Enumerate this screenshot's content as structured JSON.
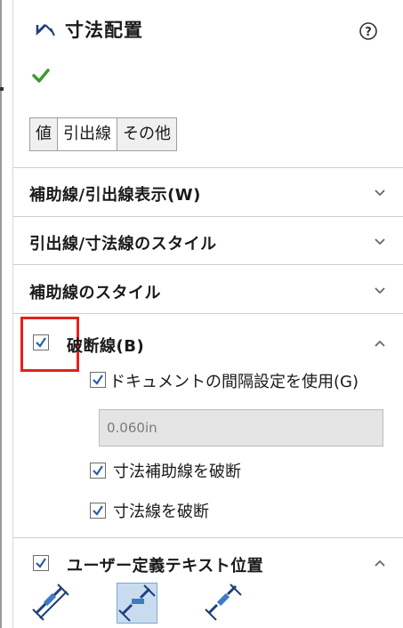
{
  "panel": {
    "title": "寸法配置",
    "icons": {
      "title": "dimension-arrow-icon",
      "help": "help-question-icon",
      "ok": "check-mark-icon"
    }
  },
  "tabs": [
    {
      "label": "値",
      "active": false
    },
    {
      "label": "引出線",
      "active": true
    },
    {
      "label": "その他",
      "active": false
    }
  ],
  "sections": {
    "extension_display": {
      "label": "補助線/引出線表示(W)",
      "state": "collapsed"
    },
    "leader_style": {
      "label": "引出線/寸法線のスタイル",
      "state": "collapsed"
    },
    "extension_style": {
      "label": "補助線のスタイル",
      "state": "collapsed"
    },
    "break_lines": {
      "label": "破断線(B)",
      "checked": true,
      "state": "expanded",
      "use_doc_gap": {
        "label": "ドキュメントの間隔設定を使用(G)",
        "checked": true
      },
      "gap_value": "0.060in",
      "break_extension": {
        "label": "寸法補助線を破断",
        "checked": true
      },
      "break_dimension": {
        "label": "寸法線を破断",
        "checked": true
      }
    },
    "custom_text_position": {
      "label": "ユーザー定義テキスト位置",
      "checked": true,
      "state": "expanded",
      "position_buttons": [
        {
          "icon": "solid-leader-aligned-text-icon",
          "selected": false
        },
        {
          "icon": "broken-leader-horizontal-text-icon",
          "selected": true
        },
        {
          "icon": "broken-leader-aligned-text-icon",
          "selected": false
        }
      ]
    }
  },
  "colors": {
    "highlight_box": "#e3221c",
    "ok_check": "#3c9a2e",
    "checkbox_mark": "#2a5fa8",
    "selected_button": "#c9dcef"
  }
}
